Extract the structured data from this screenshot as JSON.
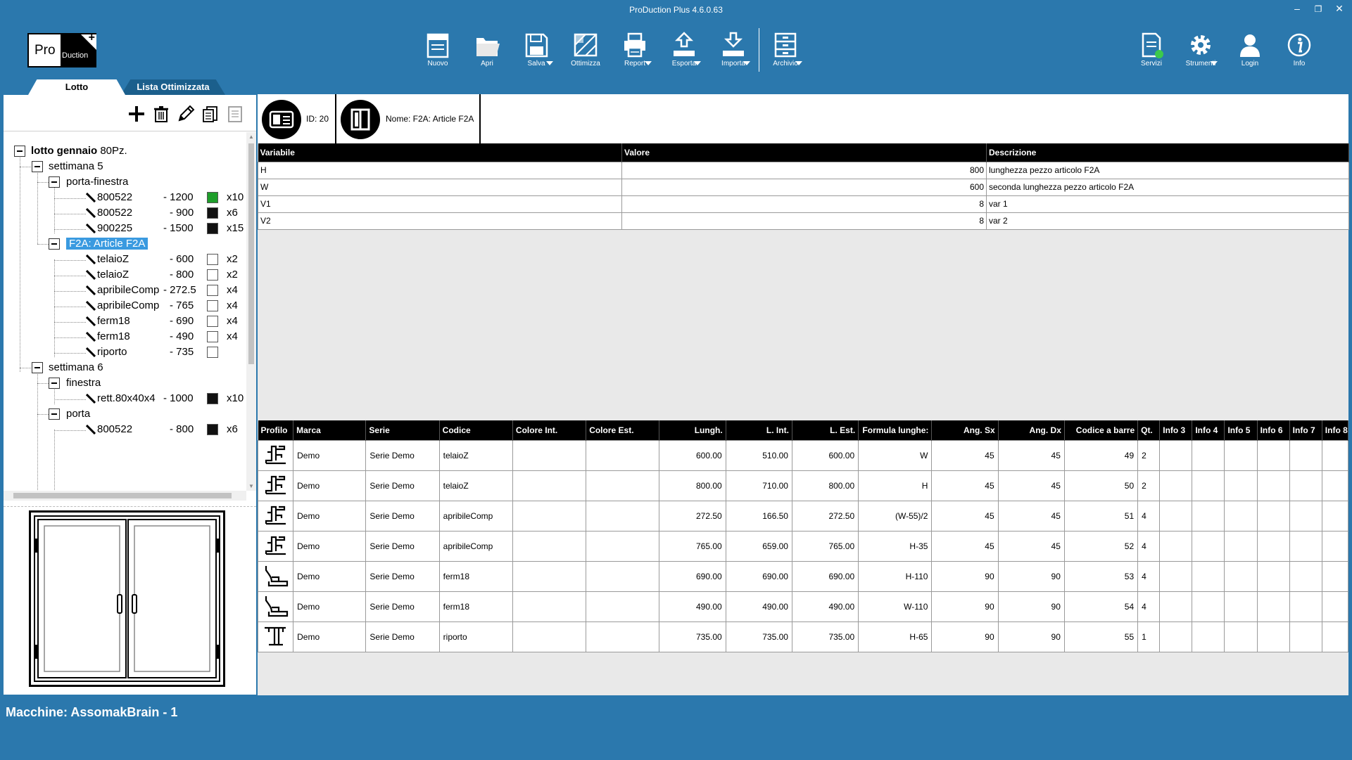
{
  "window": {
    "title": "ProDuction Plus 4.6.0.63",
    "controls": {
      "minimize": "–",
      "restore": "❐",
      "close": "✕"
    }
  },
  "logo": {
    "part1": "Pro",
    "part2": "Duction"
  },
  "toolbar": {
    "items": [
      {
        "label": "Nuovo",
        "icon": "new-icon"
      },
      {
        "label": "Apri",
        "icon": "folder-icon"
      },
      {
        "label": "Salva",
        "icon": "save-icon",
        "dropdown": true
      },
      {
        "label": "Ottimizza",
        "icon": "optimize-icon"
      },
      {
        "label": "Report",
        "icon": "printer-icon",
        "dropdown": true
      },
      {
        "label": "Esporta",
        "icon": "export-icon",
        "dropdown": true
      },
      {
        "label": "Importa",
        "icon": "import-icon",
        "dropdown": true
      },
      {
        "label": "Archivio",
        "icon": "archive-icon",
        "dropdown": true
      }
    ],
    "right_items": [
      {
        "label": "Servizi",
        "icon": "services-icon",
        "status_color": "#3cc94c"
      },
      {
        "label": "Strumenti",
        "icon": "gear-icon",
        "dropdown": true
      },
      {
        "label": "Login",
        "icon": "user-icon"
      },
      {
        "label": "Info",
        "icon": "info-icon"
      }
    ]
  },
  "tabs": {
    "active": "Lotto",
    "inactive": "Lista Ottimizzata"
  },
  "tree": {
    "root": {
      "label": "lotto gennaio",
      "suffix": "80Pz."
    },
    "nodes": [
      {
        "label": "settimana 5"
      },
      {
        "label": "porta-finestra"
      },
      {
        "code": "800522",
        "length": "- 1200",
        "qty": "x10",
        "color": "#1e9e2a"
      },
      {
        "code": "800522",
        "length": "- 900",
        "qty": "x6",
        "color": "#111111"
      },
      {
        "code": "900225",
        "length": "- 1500",
        "qty": "x15",
        "color": "#111111"
      },
      {
        "label": "F2A: Article F2A"
      },
      {
        "code": "telaioZ",
        "length": "- 600",
        "qty": "x2",
        "color": "#ffffff"
      },
      {
        "code": "telaioZ",
        "length": "- 800",
        "qty": "x2",
        "color": "#ffffff"
      },
      {
        "code": "apribileComp",
        "length": "- 272.5",
        "qty": "x4",
        "color": "#ffffff"
      },
      {
        "code": "apribileComp",
        "length": "- 765",
        "qty": "x4",
        "color": "#ffffff"
      },
      {
        "code": "ferm18",
        "length": "- 690",
        "qty": "x4",
        "color": "#ffffff"
      },
      {
        "code": "ferm18",
        "length": "- 490",
        "qty": "x4",
        "color": "#ffffff"
      },
      {
        "code": "riporto",
        "length": "- 735",
        "qty": "",
        "color": "#ffffff"
      },
      {
        "label": "settimana 6"
      },
      {
        "label": "finestra"
      },
      {
        "code": "rett.80x40x4",
        "length": "- 1000",
        "qty": "x10",
        "color": "#111111"
      },
      {
        "label": "porta"
      },
      {
        "code": "800522",
        "length": "- 800",
        "qty": "x6",
        "color": "#111111"
      }
    ]
  },
  "article": {
    "id_label": "ID: 20",
    "name_label": "Nome: F2A: Article F2A"
  },
  "variables": {
    "headers": [
      "Variabile",
      "Valore",
      "Descrizione"
    ],
    "rows": [
      [
        "H",
        "800",
        "lunghezza pezzo articolo F2A"
      ],
      [
        "W",
        "600",
        "seconda lunghezza pezzo articolo F2A"
      ],
      [
        "V1",
        "8",
        "var 1"
      ],
      [
        "V2",
        "8",
        "var 2"
      ]
    ]
  },
  "parts": {
    "headers": [
      "Profilo",
      "Marca",
      "Serie",
      "Codice",
      "Colore Int.",
      "Colore Est.",
      "Lungh.",
      "L. Int.",
      "L. Est.",
      "Formula lunghe:",
      "Ang. Sx",
      "Ang. Dx",
      "Codice a barre",
      "Qt.",
      "Info 3",
      "Info 4",
      "Info 5",
      "Info 6",
      "Info 7",
      "Info 8"
    ],
    "rows": [
      {
        "profile_icon": "profile-t-icon",
        "cells": [
          "Demo",
          "Serie Demo",
          "telaioZ",
          "",
          "",
          "600.00",
          "510.00",
          "600.00",
          "W",
          "45",
          "45",
          "49",
          "2",
          "",
          "",
          "",
          "",
          "",
          ""
        ]
      },
      {
        "profile_icon": "profile-t-icon",
        "cells": [
          "Demo",
          "Serie Demo",
          "telaioZ",
          "",
          "",
          "800.00",
          "710.00",
          "800.00",
          "H",
          "45",
          "45",
          "50",
          "2",
          "",
          "",
          "",
          "",
          "",
          ""
        ]
      },
      {
        "profile_icon": "profile-t-icon",
        "cells": [
          "Demo",
          "Serie Demo",
          "apribileComp",
          "",
          "",
          "272.50",
          "166.50",
          "272.50",
          "(W-55)/2",
          "45",
          "45",
          "51",
          "4",
          "",
          "",
          "",
          "",
          "",
          ""
        ]
      },
      {
        "profile_icon": "profile-t-icon",
        "cells": [
          "Demo",
          "Serie Demo",
          "apribileComp",
          "",
          "",
          "765.00",
          "659.00",
          "765.00",
          "H-35",
          "45",
          "45",
          "52",
          "4",
          "",
          "",
          "",
          "",
          "",
          ""
        ]
      },
      {
        "profile_icon": "profile-bead-icon",
        "cells": [
          "Demo",
          "Serie Demo",
          "ferm18",
          "",
          "",
          "690.00",
          "690.00",
          "690.00",
          "H-110",
          "90",
          "90",
          "53",
          "4",
          "",
          "",
          "",
          "",
          "",
          ""
        ]
      },
      {
        "profile_icon": "profile-bead-icon",
        "cells": [
          "Demo",
          "Serie Demo",
          "ferm18",
          "",
          "",
          "490.00",
          "490.00",
          "490.00",
          "W-110",
          "90",
          "90",
          "54",
          "4",
          "",
          "",
          "",
          "",
          "",
          ""
        ]
      },
      {
        "profile_icon": "profile-i-icon",
        "cells": [
          "Demo",
          "Serie Demo",
          "riporto",
          "",
          "",
          "735.00",
          "735.00",
          "735.00",
          "H-65",
          "90",
          "90",
          "55",
          "1",
          "",
          "",
          "",
          "",
          "",
          ""
        ]
      }
    ]
  },
  "status": {
    "text": "Macchine:  AssomakBrain - 1"
  }
}
